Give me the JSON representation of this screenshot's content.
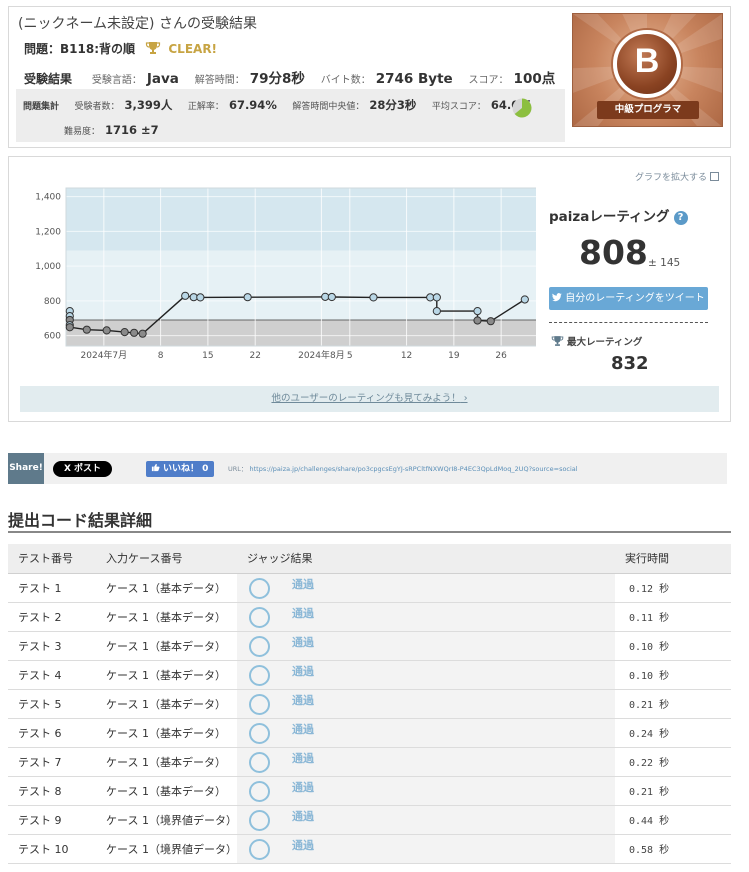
{
  "header": {
    "user_title": "(ニックネーム未設定) さんの受験結果",
    "problem_label": "問題：B118:背の順",
    "clear_label": "CLEAR!",
    "result_head": "受験結果",
    "language_label": "受験言語：",
    "language": "Java",
    "time_label": "解答時間：",
    "time": "79分8秒",
    "bytes_label": "バイト数：",
    "bytes": "2746 Byte",
    "score_label": "スコア：",
    "score": "100点"
  },
  "stats": {
    "head": "問題集計",
    "examinees_label": "受験者数：",
    "examinees": "3,399人",
    "accuracy_label": "正解率：",
    "accuracy": "67.94%",
    "median_label": "解答時間中央値：",
    "median": "28分3秒",
    "avg_label": "平均スコア：",
    "avg": "64.0点",
    "avg_ratio": 0.64,
    "difficulty_label": "難易度：",
    "difficulty": "1716 ±7"
  },
  "badge": {
    "letter": "B",
    "rank": "中級プログラマ"
  },
  "rating": {
    "expand_label": "グラフを拡大する",
    "title": "paizaレーティング",
    "value": "808",
    "error": "± 145",
    "tweet_label": "自分のレーティングをツイート",
    "max_label": "最大レーティング",
    "max_value": "832",
    "others_link": "他のユーザーのレーティングも見てみよう！"
  },
  "chart_data": {
    "type": "line",
    "title": "",
    "xlabel": "",
    "ylabel": "",
    "ylim": [
      540,
      1450
    ],
    "yticks": [
      600,
      800,
      1000,
      1200,
      1400
    ],
    "ytick_labels": [
      "600",
      "800",
      "1,000",
      "1,200",
      "1,400"
    ],
    "xlim": [
      0,
      50
    ],
    "xticks": [
      4,
      10,
      15,
      20,
      27,
      30,
      36,
      41,
      46
    ],
    "xtick_labels": [
      "2024年7月",
      "8",
      "15",
      "22",
      "2024年8月",
      "5",
      "12",
      "19",
      "26"
    ],
    "bands": [
      {
        "from": 540,
        "to": 690,
        "color": "#cfcfcf"
      },
      {
        "from": 690,
        "to": 1090,
        "color": "#e6f1f5"
      },
      {
        "from": 1090,
        "to": 1450,
        "color": "#d5e7ef"
      }
    ],
    "series": [
      {
        "x": [
          0.4,
          0.4,
          0.4,
          0.4,
          0.4,
          2.2,
          4.3,
          6.2,
          7.2,
          8.1,
          12.6,
          13.5,
          14.2,
          19.2,
          27.4,
          28.1,
          32.5,
          38.5,
          39.2,
          39.2,
          43.5,
          43.5,
          44.9,
          48.5
        ],
        "y": [
          741,
          712,
          690,
          660,
          648,
          634,
          630,
          620,
          616,
          611,
          829,
          821,
          820,
          821,
          823,
          822,
          820,
          820,
          820,
          741,
          741,
          687,
          683,
          808
        ]
      }
    ],
    "point_colors": [
      "#b9d7e6",
      "#b9d7e6",
      "#8a8a8a",
      "#b9d7e6",
      "#8a8a8a",
      "#8a8a8a",
      "#8a8a8a",
      "#8a8a8a",
      "#8a8a8a",
      "#8a8a8a",
      "#b9d7e6",
      "#b9d7e6",
      "#b9d7e6",
      "#b9d7e6",
      "#b9d7e6",
      "#b9d7e6",
      "#b9d7e6",
      "#b9d7e6",
      "#b9d7e6",
      "#b9d7e6",
      "#b9d7e6",
      "#8a8a8a",
      "#8a8a8a",
      "#b9d7e6"
    ]
  },
  "share": {
    "tag": "Share!",
    "x_label": "X ポスト",
    "like_label": "いいね！ 0",
    "url_label": "URL：",
    "url": "https://paiza.jp/challenges/share/po3cpgcsEgYJ-sRPCltfNXWQrI8-P4EC3QpLdMoq_2UQ?source=social"
  },
  "details": {
    "title": "提出コード結果詳細",
    "columns": [
      "テスト番号",
      "入力ケース番号",
      "ジャッジ結果",
      "実行時間"
    ],
    "rows": [
      {
        "test": "テスト 1",
        "case": "ケース 1（基本データ）",
        "judge": "通過",
        "time": "0.12 秒"
      },
      {
        "test": "テスト 2",
        "case": "ケース 1（基本データ）",
        "judge": "通過",
        "time": "0.11 秒"
      },
      {
        "test": "テスト 3",
        "case": "ケース 1（基本データ）",
        "judge": "通過",
        "time": "0.10 秒"
      },
      {
        "test": "テスト 4",
        "case": "ケース 1（基本データ）",
        "judge": "通過",
        "time": "0.10 秒"
      },
      {
        "test": "テスト 5",
        "case": "ケース 1（基本データ）",
        "judge": "通過",
        "time": "0.21 秒"
      },
      {
        "test": "テスト 6",
        "case": "ケース 1（基本データ）",
        "judge": "通過",
        "time": "0.24 秒"
      },
      {
        "test": "テスト 7",
        "case": "ケース 1（基本データ）",
        "judge": "通過",
        "time": "0.22 秒"
      },
      {
        "test": "テスト 8",
        "case": "ケース 1（基本データ）",
        "judge": "通過",
        "time": "0.21 秒"
      },
      {
        "test": "テスト 9",
        "case": "ケース 1（境界値データ）",
        "judge": "通過",
        "time": "0.44 秒"
      },
      {
        "test": "テスト 10",
        "case": "ケース 1（境界値データ）",
        "judge": "通過",
        "time": "0.58 秒"
      }
    ]
  },
  "colors": {
    "clear_gold": "#c7a443",
    "tweet_blue": "#69a8d6",
    "pass_blue": "#8ab7d6",
    "pie_green": "#8cbf3f"
  }
}
